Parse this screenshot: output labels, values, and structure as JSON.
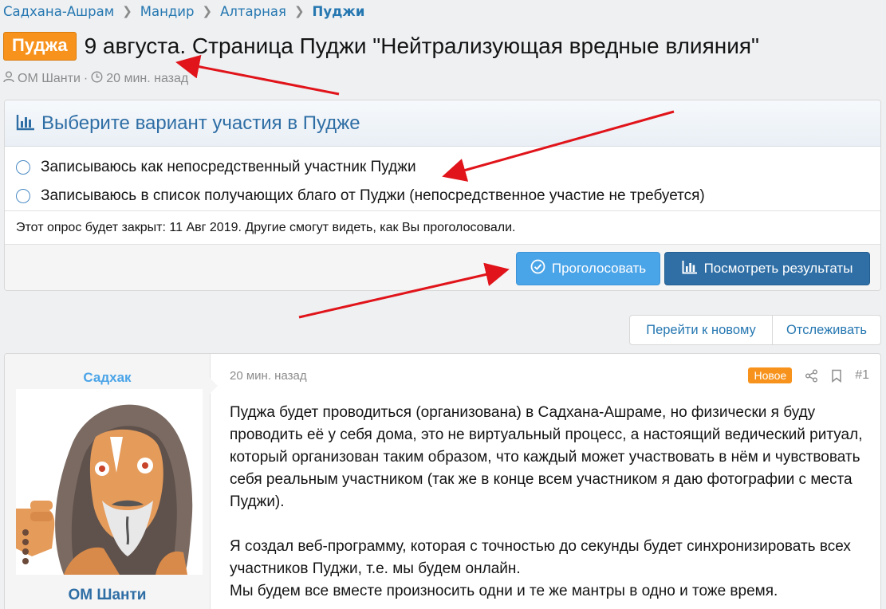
{
  "breadcrumb": {
    "items": [
      "Садхана-Ашрам",
      "Мандир",
      "Алтарная"
    ],
    "current": "Пуджи"
  },
  "thread": {
    "prefix": "Пуджа",
    "title": "9 августа. Страница Пуджи \"Нейтрализующая вредные влияния\"",
    "author": "ОМ Шанти",
    "time": "20 мин. назад"
  },
  "poll": {
    "heading": "Выберите вариант участия в Пудже",
    "options": [
      "Записываюсь как непосредственный участник Пуджи",
      "Записываюсь в список получающих благо от Пуджи (непосредственное участие не требуется)"
    ],
    "note": "Этот опрос будет закрыт: 11 Авг 2019. Другие смогут видеть, как Вы проголосовали.",
    "vote_label": "Проголосовать",
    "results_label": "Посмотреть результаты"
  },
  "tools": {
    "goto_new": "Перейти к новому",
    "watch": "Отслеживать"
  },
  "post": {
    "username_top": "Садхак",
    "username_bottom": "ОМ Шанти",
    "time": "20 мин. назад",
    "badge": "Новое",
    "number": "#1",
    "paragraph1": "Пуджа будет проводиться (организована) в Садхана-Ашраме, но физически я буду проводить её у себя дома, это не виртуальный процесс, а настоящий ведический ритуал, который организован таким образом, что каждый может участвовать в нём и чувствовать себя реальным участником (так же в конце всем участником я даю фотографии с места Пуджи).",
    "paragraph2_line1": "Я создал веб-программу, которая с точностью до секунды будет синхронизировать всех участников Пуджи, т.е. мы будем онлайн.",
    "paragraph2_line2": "Мы будем все вместе произносить одни и те же мантры в одно и тоже время."
  },
  "icons": {
    "user": "user-icon",
    "clock": "clock-icon",
    "chart": "bar-chart-icon",
    "check": "check-circle-icon",
    "share": "share-icon",
    "bookmark": "bookmark-icon",
    "chevron": "chevron-right-icon"
  },
  "colors": {
    "link": "#2577b1",
    "prefix_orange": "#f7931d",
    "vote_button": "#4aa4e8",
    "results_button": "#2f6fa6",
    "annotation_arrow": "#e0141a"
  }
}
